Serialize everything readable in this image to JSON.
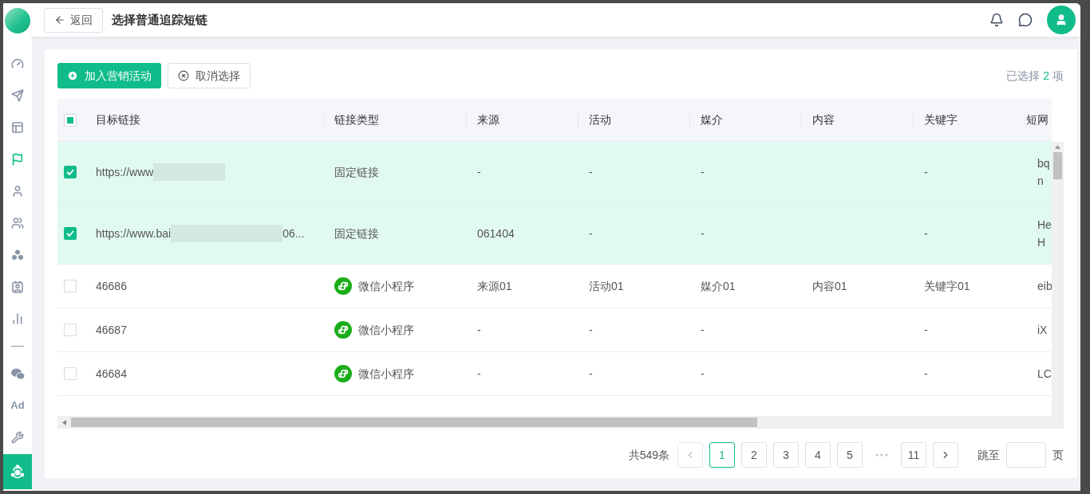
{
  "sidebar": {
    "items": [
      {
        "kind": "icon",
        "selected": false,
        "highlighted": false
      },
      {
        "kind": "icon",
        "selected": false,
        "highlighted": false
      },
      {
        "kind": "icon",
        "selected": false,
        "highlighted": false
      },
      {
        "kind": "icon",
        "selected": false,
        "highlighted": true
      },
      {
        "kind": "icon",
        "selected": false,
        "highlighted": false
      },
      {
        "kind": "icon",
        "selected": false,
        "highlighted": false
      },
      {
        "kind": "icon",
        "selected": false,
        "highlighted": false
      },
      {
        "kind": "icon",
        "selected": false,
        "highlighted": false
      },
      {
        "kind": "icon",
        "selected": false,
        "highlighted": false
      },
      {
        "kind": "divider"
      },
      {
        "kind": "icon",
        "selected": false,
        "highlighted": false
      },
      {
        "kind": "text",
        "label": "Ad",
        "selected": false,
        "highlighted": false
      },
      {
        "kind": "icon",
        "selected": false,
        "highlighted": false
      },
      {
        "kind": "icon",
        "selected": true
      }
    ]
  },
  "header": {
    "back_button": "返回",
    "title": "选择普通追踪短链"
  },
  "toolbar": {
    "add_button": "加入营销活动",
    "cancel_button": "取消选择",
    "selection_text": "已选择 **2** 项"
  },
  "table": {
    "select_all": {
      "indeterminate": true
    },
    "columns": [
      "目标链接",
      "链接类型",
      "来源",
      "活动",
      "媒介",
      "内容",
      "关键字",
      "短网"
    ],
    "rows": [
      {
        "checked": true,
        "url": "https://www",
        "redacted": true,
        "url_suffix": "",
        "link_type": {
          "kind": "fixed",
          "label": "固定链接"
        },
        "source": "-",
        "campaign": "-",
        "medium": "-",
        "content": "",
        "keyword": "-",
        "column_8": [
          "bq",
          "n"
        ]
      },
      {
        "checked": true,
        "url": "https://www.bai",
        "redacted": true,
        "url_suffix": "06...",
        "link_type": {
          "kind": "fixed",
          "label": "固定链接"
        },
        "source": "061404",
        "campaign": "-",
        "medium": "-",
        "content": "",
        "keyword": "-",
        "column_8": [
          "He",
          "H"
        ]
      },
      {
        "checked": false,
        "url": "46686",
        "redacted": false,
        "url_suffix": "",
        "link_type": {
          "kind": "mini_program",
          "label": "微信小程序"
        },
        "source": "来源01",
        "campaign": "活动01",
        "medium": "媒介01",
        "content": "内容01",
        "keyword": "关键字01",
        "column_8": [
          "eib"
        ]
      },
      {
        "checked": false,
        "url": "46687",
        "redacted": false,
        "url_suffix": "",
        "link_type": {
          "kind": "mini_program",
          "label": "微信小程序"
        },
        "source": "-",
        "campaign": "-",
        "medium": "-",
        "content": "",
        "keyword": "-",
        "column_8": [
          "iX"
        ]
      },
      {
        "checked": false,
        "url": "46684",
        "redacted": false,
        "url_suffix": "",
        "link_type": {
          "kind": "mini_program",
          "label": "微信小程序"
        },
        "source": "-",
        "campaign": "-",
        "medium": "-",
        "content": "",
        "keyword": "-",
        "column_8": [
          "LC"
        ]
      }
    ]
  },
  "pagination": {
    "total": "共549条",
    "prev_disabled": true,
    "pages": [
      {
        "label": "1",
        "selected": true
      },
      {
        "label": "2",
        "selected": false
      },
      {
        "label": "3",
        "selected": false
      },
      {
        "label": "4",
        "selected": false
      },
      {
        "label": "5",
        "selected": false
      },
      {
        "kind": "ellipsis"
      },
      {
        "label": "11",
        "selected": false
      }
    ],
    "jump_label": "跳至",
    "jump_unit": "页"
  }
}
